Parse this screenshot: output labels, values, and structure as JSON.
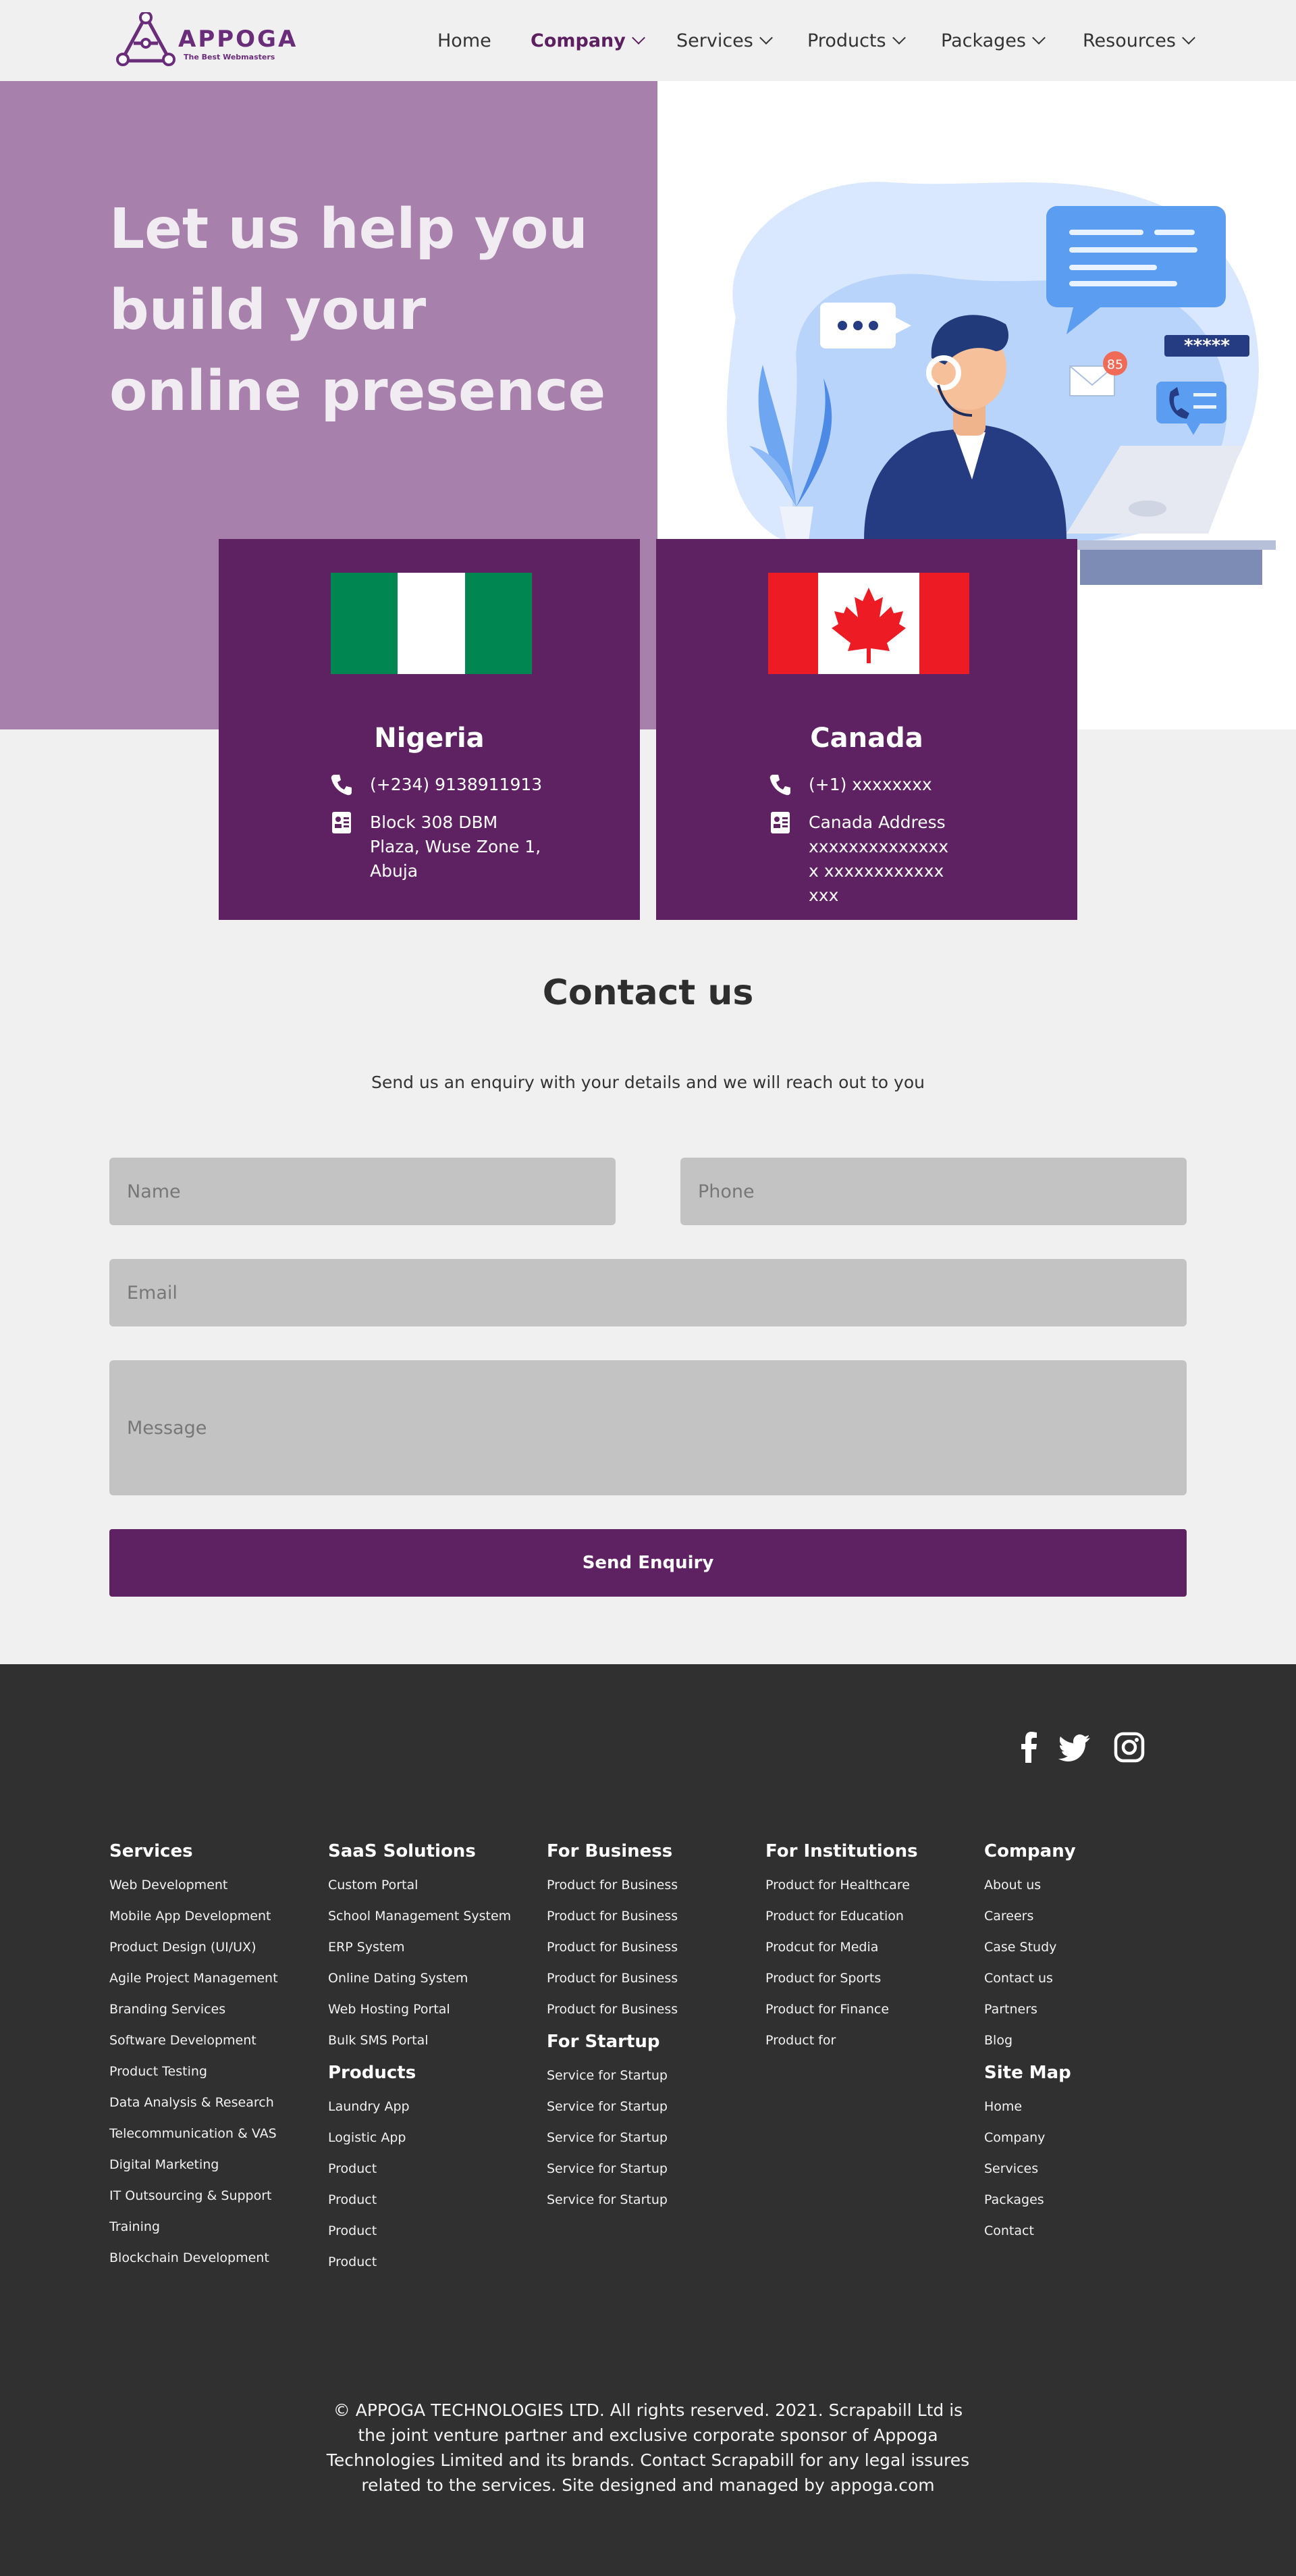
{
  "nav": {
    "logo_text": "APPOGA",
    "logo_tagline": "The Best Webmasters",
    "items": [
      {
        "label": "Home",
        "has_dropdown": false,
        "active": false
      },
      {
        "label": "Company",
        "has_dropdown": true,
        "active": true
      },
      {
        "label": "Services",
        "has_dropdown": true,
        "active": false
      },
      {
        "label": "Products",
        "has_dropdown": true,
        "active": false
      },
      {
        "label": "Packages",
        "has_dropdown": true,
        "active": false
      },
      {
        "label": "Resources",
        "has_dropdown": true,
        "active": false
      }
    ]
  },
  "hero": {
    "title": "Let us help you build your online presence",
    "illustration_badge": "85",
    "illustration_password": "*****"
  },
  "offices": [
    {
      "country": "Nigeria",
      "phone": "(+234) 9138911913",
      "address": "Block 308 DBM Plaza, Wuse Zone 1, Abuja",
      "flag_icon": "nigeria-flag-icon"
    },
    {
      "country": "Canada",
      "phone": "(+1) xxxxxxxx",
      "address": "Canada Address xxxxxxxxxxxxxxx xxxxxxxxxxxxxxx",
      "flag_icon": "canada-flag-icon"
    }
  ],
  "contact": {
    "title": "Contact us",
    "subtitle": "Send us an enquiry with your details and we will reach out to you",
    "name_placeholder": "Name",
    "phone_placeholder": "Phone",
    "email_placeholder": "Email",
    "message_placeholder": "Message",
    "submit_label": "Send Enquiry"
  },
  "footer": {
    "social": [
      "facebook-icon",
      "twitter-icon",
      "instagram-icon"
    ],
    "columns": [
      {
        "title": "Services",
        "items": [
          "Web Development",
          "Mobile App Development",
          "Product Design (UI/UX)",
          "Agile Project Management",
          "Branding Services",
          "Software Development",
          "Product Testing",
          "Data Analysis & Research",
          "Telecommunication & VAS",
          "Digital Marketing",
          "IT Outsourcing & Support",
          "Training",
          "Blockchain Development"
        ]
      },
      {
        "title": "SaaS Solutions",
        "items": [
          "Custom Portal",
          "School Management System",
          "ERP System",
          "Online Dating System",
          "Web Hosting Portal",
          "Bulk SMS Portal"
        ],
        "sub_title": "Products",
        "sub_items": [
          "Laundry App",
          "Logistic App",
          "Product",
          "Product",
          "Product",
          "Product"
        ]
      },
      {
        "title": "For Business",
        "items": [
          "Product for Business",
          "Product for Business",
          "Product for Business",
          "Product for Business",
          "Product for Business"
        ],
        "sub_title": "For Startup",
        "sub_items": [
          "Service for Startup",
          "Service for Startup",
          "Service for Startup",
          "Service for Startup",
          "Service for Startup"
        ]
      },
      {
        "title": "For Institutions",
        "items": [
          "Product for Healthcare",
          "Product for Education",
          "Prodcut for Media",
          "Product for Sports",
          "Product for Finance",
          "Product for"
        ]
      },
      {
        "title": "Company",
        "items": [
          "About us",
          "Careers",
          "Case Study",
          "Contact us",
          "Partners",
          "Blog"
        ],
        "sub_title": "Site Map",
        "sub_items": [
          "Home",
          "Company",
          "Services",
          "Packages",
          "Contact"
        ]
      }
    ],
    "copyright": "© APPOGA TECHNOLOGIES LTD. All rights reserved. 2021. Scrapabill Ltd is the joint venture partner and exclusive corporate sponsor of Appoga Technologies Limited and its brands. Contact Scrapabill for any legal issures related to the services. Site designed and managed by appoga.com"
  },
  "colors": {
    "brand_purple": "#5e2262",
    "hero_lilac": "#a781ab",
    "footer_bg": "#303030",
    "field_bg": "#c3c3c3"
  }
}
